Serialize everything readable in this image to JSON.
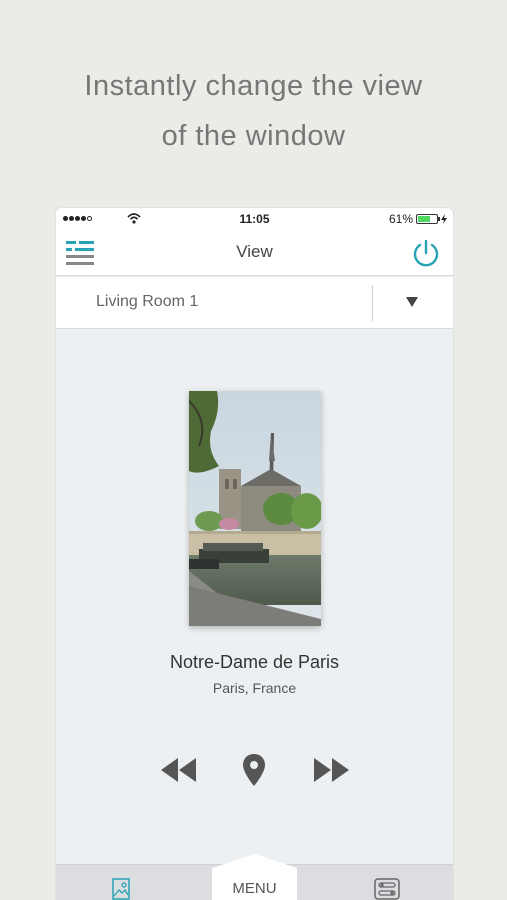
{
  "headline": {
    "line1": "Instantly change the view",
    "line2": "of the window"
  },
  "status_bar": {
    "time": "11:05",
    "battery": "61%"
  },
  "nav": {
    "title": "View",
    "menu_icon": "menu-lines-icon",
    "power_icon": "power-icon"
  },
  "room_selector": {
    "selected": "Living Room 1"
  },
  "view": {
    "name": "Notre-Dame de Paris",
    "location": "Paris, France"
  },
  "controls": {
    "previous_icon": "rewind-icon",
    "location_icon": "location-pin-icon",
    "next_icon": "fast-forward-icon"
  },
  "tab_bar": {
    "menu_label": "MENU",
    "left_icon": "picture-icon",
    "right_icon": "toggles-icon"
  },
  "colors": {
    "accent": "#27a3b5",
    "background": "#ebebe8",
    "screen": "#edf0f2"
  }
}
